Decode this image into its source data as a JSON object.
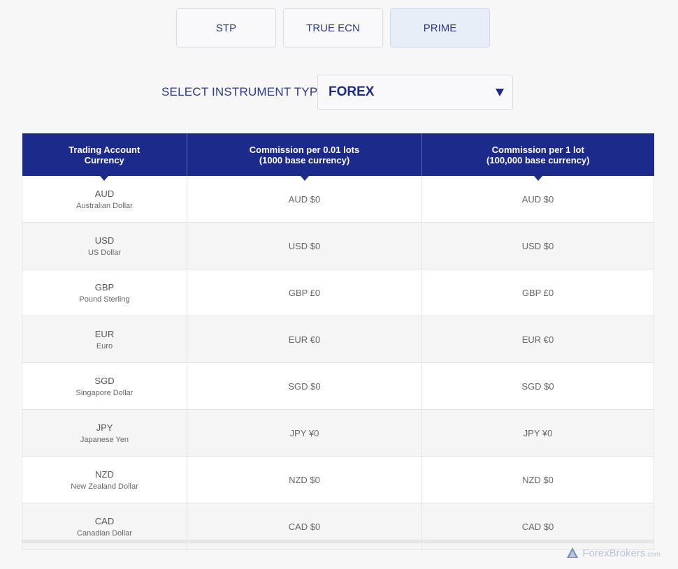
{
  "tabs": [
    {
      "label": "STP"
    },
    {
      "label": "TRUE ECN"
    },
    {
      "label": "PRIME"
    }
  ],
  "instrument": {
    "label": "SELECT INSTRUMENT TYPE:",
    "selected": "FOREX"
  },
  "table": {
    "headers": [
      [
        "Trading Account",
        "Currency"
      ],
      [
        "Commission per 0.01 lots",
        "(1000 base currency)"
      ],
      [
        "Commission per 1 lot",
        "(100,000 base currency)"
      ]
    ],
    "rows": [
      {
        "code": "AUD",
        "name": "Australian Dollar",
        "per_001": "AUD $0",
        "per_1": "AUD $0"
      },
      {
        "code": "USD",
        "name": "US Dollar",
        "per_001": "USD $0",
        "per_1": "USD $0"
      },
      {
        "code": "GBP",
        "name": "Pound Sterling",
        "per_001": "GBP £0",
        "per_1": "GBP £0"
      },
      {
        "code": "EUR",
        "name": "Euro",
        "per_001": "EUR €0",
        "per_1": "EUR €0"
      },
      {
        "code": "SGD",
        "name": "Singapore Dollar",
        "per_001": "SGD $0",
        "per_1": "SGD $0"
      },
      {
        "code": "JPY",
        "name": "Japanese Yen",
        "per_001": "JPY ¥0",
        "per_1": "JPY ¥0"
      },
      {
        "code": "NZD",
        "name": "New Zealand Dollar",
        "per_001": "NZD $0",
        "per_1": "NZD $0"
      },
      {
        "code": "CAD",
        "name": "Canadian Dollar",
        "per_001": "CAD $0",
        "per_1": "CAD $0"
      }
    ]
  },
  "watermark": {
    "brand": "ForexBrokers",
    "suffix": ".com",
    "icon": "forexbrokers-logo-icon"
  },
  "colors": {
    "header_bg": "#1c2a8c",
    "accent_text": "#2d3a8c",
    "active_tab_bg": "#e8eef8"
  }
}
